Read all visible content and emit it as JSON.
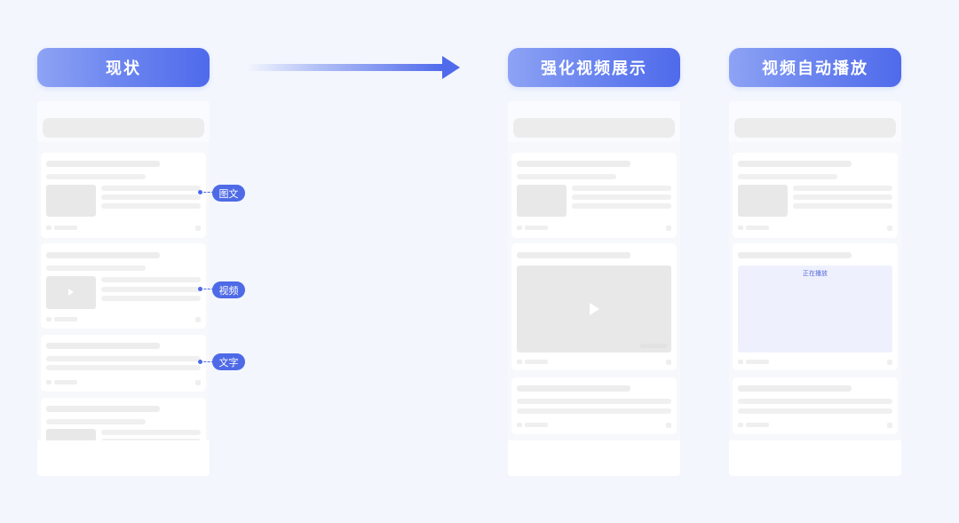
{
  "headers": {
    "current": "现状",
    "enhanced": "强化视频展示",
    "autoplay": "视频自动播放"
  },
  "annotations": [
    {
      "label": "图文",
      "meaning": "image-text post"
    },
    {
      "label": "视频",
      "meaning": "video post"
    },
    {
      "label": "文字",
      "meaning": "text post"
    }
  ],
  "autoplay_status": "正在播放",
  "colors": {
    "accent": "#4e6ae6",
    "gradient_start": "#8ea3f4",
    "gradient_end": "#4f6aeb",
    "background": "#f3f6fd",
    "autoplay_fill": "#eef1fd"
  }
}
